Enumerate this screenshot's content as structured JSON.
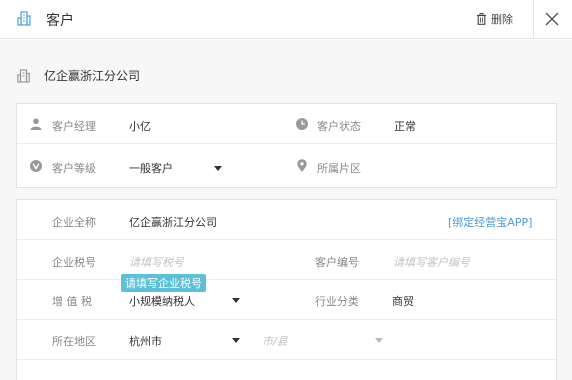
{
  "header": {
    "title": "客户",
    "delete_label": "删除"
  },
  "company_name": "亿企赢浙江分公司",
  "basic": {
    "manager_label": "客户经理",
    "manager_value": "小亿",
    "status_label": "客户状态",
    "status_value": "正常",
    "level_label": "客户等级",
    "level_value": "一般客户",
    "region_label": "所属片区"
  },
  "detail": {
    "fullname_label": "企业全称",
    "fullname_value": "亿企赢浙江分公司",
    "bind_link": "[绑定经营宝APP]",
    "tax_label": "企业税号",
    "tax_placeholder": "请填写税号",
    "tax_tip": "请填写企业税号",
    "code_label": "客户编号",
    "code_placeholder": "请填写客户编号",
    "vat_label": "增 值 税",
    "vat_value": "小规模纳税人",
    "industry_label": "行业分类",
    "industry_value": "商贸",
    "area_label": "所在地区",
    "city_value": "杭州市",
    "county_placeholder": "市/县"
  }
}
